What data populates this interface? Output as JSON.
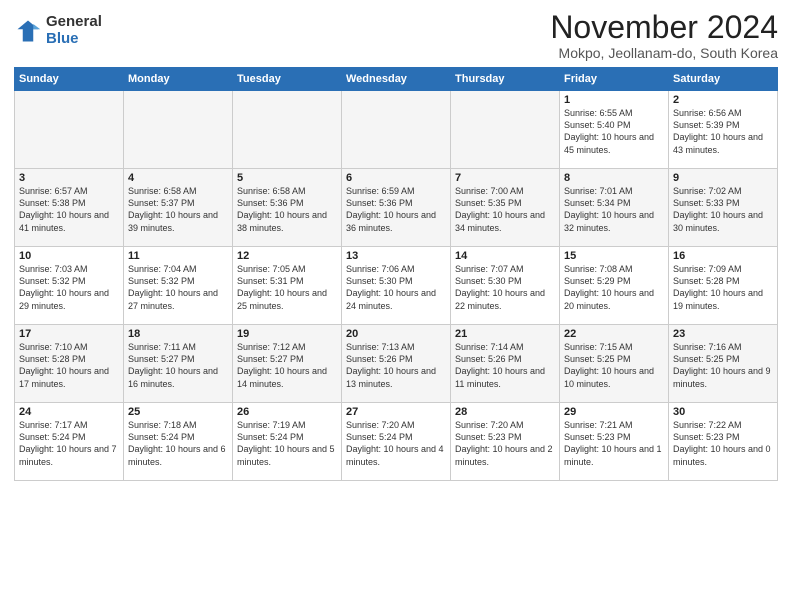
{
  "header": {
    "logo_general": "General",
    "logo_blue": "Blue",
    "month_title": "November 2024",
    "location": "Mokpo, Jeollanam-do, South Korea"
  },
  "weekdays": [
    "Sunday",
    "Monday",
    "Tuesday",
    "Wednesday",
    "Thursday",
    "Friday",
    "Saturday"
  ],
  "weeks": [
    [
      {
        "day": "",
        "empty": true
      },
      {
        "day": "",
        "empty": true
      },
      {
        "day": "",
        "empty": true
      },
      {
        "day": "",
        "empty": true
      },
      {
        "day": "",
        "empty": true
      },
      {
        "day": "1",
        "sunrise": "Sunrise: 6:55 AM",
        "sunset": "Sunset: 5:40 PM",
        "daylight": "Daylight: 10 hours and 45 minutes."
      },
      {
        "day": "2",
        "sunrise": "Sunrise: 6:56 AM",
        "sunset": "Sunset: 5:39 PM",
        "daylight": "Daylight: 10 hours and 43 minutes."
      }
    ],
    [
      {
        "day": "3",
        "sunrise": "Sunrise: 6:57 AM",
        "sunset": "Sunset: 5:38 PM",
        "daylight": "Daylight: 10 hours and 41 minutes."
      },
      {
        "day": "4",
        "sunrise": "Sunrise: 6:58 AM",
        "sunset": "Sunset: 5:37 PM",
        "daylight": "Daylight: 10 hours and 39 minutes."
      },
      {
        "day": "5",
        "sunrise": "Sunrise: 6:58 AM",
        "sunset": "Sunset: 5:36 PM",
        "daylight": "Daylight: 10 hours and 38 minutes."
      },
      {
        "day": "6",
        "sunrise": "Sunrise: 6:59 AM",
        "sunset": "Sunset: 5:36 PM",
        "daylight": "Daylight: 10 hours and 36 minutes."
      },
      {
        "day": "7",
        "sunrise": "Sunrise: 7:00 AM",
        "sunset": "Sunset: 5:35 PM",
        "daylight": "Daylight: 10 hours and 34 minutes."
      },
      {
        "day": "8",
        "sunrise": "Sunrise: 7:01 AM",
        "sunset": "Sunset: 5:34 PM",
        "daylight": "Daylight: 10 hours and 32 minutes."
      },
      {
        "day": "9",
        "sunrise": "Sunrise: 7:02 AM",
        "sunset": "Sunset: 5:33 PM",
        "daylight": "Daylight: 10 hours and 30 minutes."
      }
    ],
    [
      {
        "day": "10",
        "sunrise": "Sunrise: 7:03 AM",
        "sunset": "Sunset: 5:32 PM",
        "daylight": "Daylight: 10 hours and 29 minutes."
      },
      {
        "day": "11",
        "sunrise": "Sunrise: 7:04 AM",
        "sunset": "Sunset: 5:32 PM",
        "daylight": "Daylight: 10 hours and 27 minutes."
      },
      {
        "day": "12",
        "sunrise": "Sunrise: 7:05 AM",
        "sunset": "Sunset: 5:31 PM",
        "daylight": "Daylight: 10 hours and 25 minutes."
      },
      {
        "day": "13",
        "sunrise": "Sunrise: 7:06 AM",
        "sunset": "Sunset: 5:30 PM",
        "daylight": "Daylight: 10 hours and 24 minutes."
      },
      {
        "day": "14",
        "sunrise": "Sunrise: 7:07 AM",
        "sunset": "Sunset: 5:30 PM",
        "daylight": "Daylight: 10 hours and 22 minutes."
      },
      {
        "day": "15",
        "sunrise": "Sunrise: 7:08 AM",
        "sunset": "Sunset: 5:29 PM",
        "daylight": "Daylight: 10 hours and 20 minutes."
      },
      {
        "day": "16",
        "sunrise": "Sunrise: 7:09 AM",
        "sunset": "Sunset: 5:28 PM",
        "daylight": "Daylight: 10 hours and 19 minutes."
      }
    ],
    [
      {
        "day": "17",
        "sunrise": "Sunrise: 7:10 AM",
        "sunset": "Sunset: 5:28 PM",
        "daylight": "Daylight: 10 hours and 17 minutes."
      },
      {
        "day": "18",
        "sunrise": "Sunrise: 7:11 AM",
        "sunset": "Sunset: 5:27 PM",
        "daylight": "Daylight: 10 hours and 16 minutes."
      },
      {
        "day": "19",
        "sunrise": "Sunrise: 7:12 AM",
        "sunset": "Sunset: 5:27 PM",
        "daylight": "Daylight: 10 hours and 14 minutes."
      },
      {
        "day": "20",
        "sunrise": "Sunrise: 7:13 AM",
        "sunset": "Sunset: 5:26 PM",
        "daylight": "Daylight: 10 hours and 13 minutes."
      },
      {
        "day": "21",
        "sunrise": "Sunrise: 7:14 AM",
        "sunset": "Sunset: 5:26 PM",
        "daylight": "Daylight: 10 hours and 11 minutes."
      },
      {
        "day": "22",
        "sunrise": "Sunrise: 7:15 AM",
        "sunset": "Sunset: 5:25 PM",
        "daylight": "Daylight: 10 hours and 10 minutes."
      },
      {
        "day": "23",
        "sunrise": "Sunrise: 7:16 AM",
        "sunset": "Sunset: 5:25 PM",
        "daylight": "Daylight: 10 hours and 9 minutes."
      }
    ],
    [
      {
        "day": "24",
        "sunrise": "Sunrise: 7:17 AM",
        "sunset": "Sunset: 5:24 PM",
        "daylight": "Daylight: 10 hours and 7 minutes."
      },
      {
        "day": "25",
        "sunrise": "Sunrise: 7:18 AM",
        "sunset": "Sunset: 5:24 PM",
        "daylight": "Daylight: 10 hours and 6 minutes."
      },
      {
        "day": "26",
        "sunrise": "Sunrise: 7:19 AM",
        "sunset": "Sunset: 5:24 PM",
        "daylight": "Daylight: 10 hours and 5 minutes."
      },
      {
        "day": "27",
        "sunrise": "Sunrise: 7:20 AM",
        "sunset": "Sunset: 5:24 PM",
        "daylight": "Daylight: 10 hours and 4 minutes."
      },
      {
        "day": "28",
        "sunrise": "Sunrise: 7:20 AM",
        "sunset": "Sunset: 5:23 PM",
        "daylight": "Daylight: 10 hours and 2 minutes."
      },
      {
        "day": "29",
        "sunrise": "Sunrise: 7:21 AM",
        "sunset": "Sunset: 5:23 PM",
        "daylight": "Daylight: 10 hours and 1 minute."
      },
      {
        "day": "30",
        "sunrise": "Sunrise: 7:22 AM",
        "sunset": "Sunset: 5:23 PM",
        "daylight": "Daylight: 10 hours and 0 minutes."
      }
    ]
  ]
}
